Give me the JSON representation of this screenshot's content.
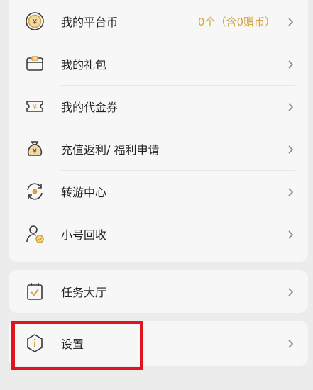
{
  "menu": {
    "items": [
      {
        "label": "我的平台币",
        "value": "0个（含0赠币）",
        "icon": "coin-icon"
      },
      {
        "label": "我的礼包",
        "icon": "gift-card-icon"
      },
      {
        "label": "我的代金券",
        "icon": "voucher-icon"
      },
      {
        "label": "充值返利/ 福利申请",
        "icon": "money-bag-icon"
      },
      {
        "label": "转游中心",
        "icon": "transfer-icon"
      },
      {
        "label": "小号回收",
        "icon": "user-recycle-icon"
      }
    ]
  },
  "tasks": {
    "label": "任务大厅",
    "icon": "task-clipboard-icon"
  },
  "settings": {
    "label": "设置",
    "icon": "info-hexagon-icon"
  },
  "colors": {
    "icon_stroke": "#3a3a3a",
    "icon_accent": "#d4a23a",
    "value_text": "#d4a23a",
    "highlight_border": "#e0141c"
  }
}
